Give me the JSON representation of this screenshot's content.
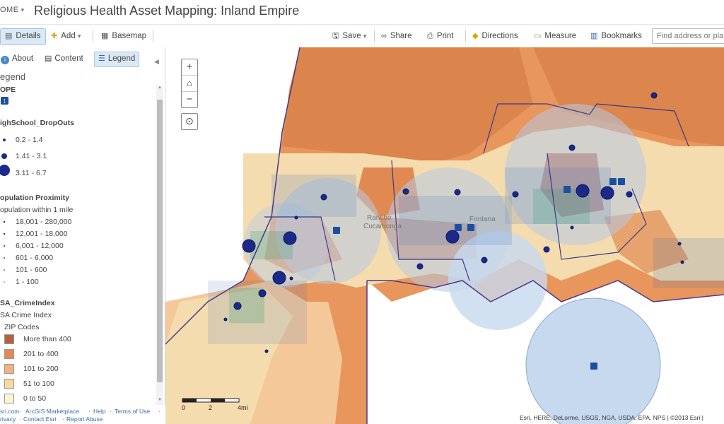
{
  "header": {
    "home_label": "OME",
    "title": "Religious Health Asset Mapping: Inland Empire"
  },
  "toolbar": {
    "details_label": "Details",
    "add_label": "Add",
    "basemap_label": "Basemap",
    "save_label": "Save",
    "share_label": "Share",
    "print_label": "Print",
    "directions_label": "Directions",
    "measure_label": "Measure",
    "bookmarks_label": "Bookmarks",
    "search_placeholder": "Find address or pla"
  },
  "panel": {
    "tabs": {
      "about": "About",
      "content": "Content",
      "legend": "Legend"
    },
    "legend_heading": "egend",
    "layers": {
      "hope": {
        "title": "OPE"
      },
      "dropouts": {
        "title": "ighSchool_DropOuts",
        "classes": [
          "0.2 - 1.4",
          "1.41 - 3.1",
          "3.11 - 6.7"
        ]
      },
      "proximity": {
        "title": "opulation Proximity",
        "subtitle": "opulation within 1 mile",
        "classes": [
          "18,001 - 280,000",
          "12,001 - 18,000",
          "6,001 - 12,000",
          "601 - 6,000",
          "101 - 600",
          "1 - 100"
        ]
      },
      "crime": {
        "title": "SA_CrimeIndex",
        "subtitle": "SA Crime Index",
        "group": "ZIP Codes",
        "classes": [
          "More than 400",
          "201 to 400",
          "101 to 200",
          "51 to 100",
          "0 to 50"
        ],
        "colors": [
          "#b5613e",
          "#e08a52",
          "#f4b080",
          "#f7d9a0",
          "#fdf5cf"
        ]
      }
    }
  },
  "footer": {
    "links": [
      "sri.com",
      "ArcGIS Marketplace",
      "Help",
      "Terms of Use",
      "rivacy",
      "Contact Esri",
      "Report Abuse"
    ]
  },
  "map": {
    "attribution": "Esri, HERE, DeLorme, USGS, NGA, USDA, EPA, NPS | ©2013 Esri |",
    "scale": {
      "t0": "0",
      "t1": "2",
      "t2": "4mi"
    },
    "labels": {
      "rancho": "Rancho",
      "cucamonga": "Cucamonga",
      "fontana": "Fontana"
    },
    "colors": {
      "orange_dark": "#d9824a",
      "orange_mid": "#e8965c",
      "peach": "#f5c89a",
      "tan": "#f4dcae",
      "buffer": "#c7d9ef",
      "dot": "#1b2a8a"
    }
  }
}
